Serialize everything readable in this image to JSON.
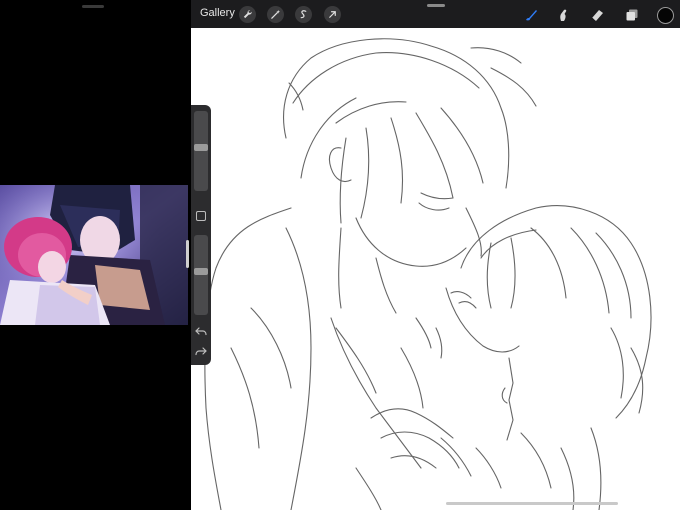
{
  "toolbar": {
    "gallery_label": "Gallery",
    "left_tools": [
      "wrench-icon",
      "magic-wand-icon",
      "selection-icon",
      "transform-arrow-icon"
    ],
    "right_tools": [
      "brush-icon",
      "smudge-icon",
      "eraser-icon",
      "layers-icon"
    ],
    "active_tool": "brush-icon",
    "accent_color": "#2f7cf6",
    "current_color": "#050505"
  },
  "sidebar": {
    "brush_size": 0.55,
    "brush_opacity": 0.55
  },
  "colors": {
    "toolbar_bg": "#1c1c1e",
    "canvas_bg": "#ffffff",
    "sidebar_bg": "#2c2c2e"
  }
}
